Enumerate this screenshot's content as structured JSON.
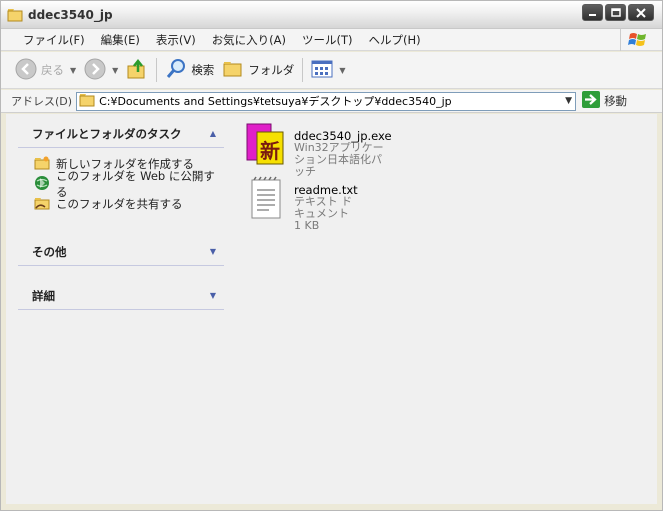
{
  "window": {
    "title": "ddec3540_jp"
  },
  "menubar": {
    "items": [
      "ファイル(F)",
      "編集(E)",
      "表示(V)",
      "お気に入り(A)",
      "ツール(T)",
      "ヘルプ(H)"
    ]
  },
  "toolbar": {
    "back_label": "戻る",
    "search_label": "検索",
    "folders_label": "フォルダ"
  },
  "address": {
    "label": "アドレス(D)",
    "path": "C:¥Documents and Settings¥tetsuya¥デスクトップ¥ddec3540_jp",
    "go_label": "移動"
  },
  "taskpane": {
    "tasks_title": "ファイルとフォルダのタスク",
    "tasks": [
      "新しいフォルダを作成する",
      "このフォルダを Web に公開する",
      "このフォルダを共有する"
    ],
    "other_title": "その他",
    "details_title": "詳細"
  },
  "files": [
    {
      "name": "ddec3540_jp.exe",
      "line2": "Win32アプリケーション日本語化パッチ",
      "line3": "",
      "icon": "installer-exe-icon"
    },
    {
      "name": "readme.txt",
      "line2": "テキスト ドキュメント",
      "line3": "1 KB",
      "icon": "text-document-icon"
    }
  ],
  "colors": {
    "accent": "#4a5fa8",
    "window_bg": "#ece9d8",
    "content_bg": "#f0f0f0"
  }
}
